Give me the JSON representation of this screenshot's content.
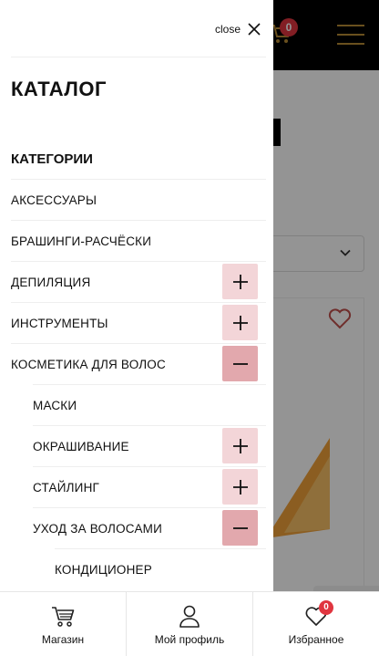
{
  "background": {
    "cart_count": "0"
  },
  "drawer": {
    "close_label": "close",
    "title": "КАТАЛОГ",
    "section_label": "КАТЕГОРИИ",
    "items": [
      {
        "label": "АКСЕССУАРЫ",
        "toggle": "none",
        "indent": 0
      },
      {
        "label": "БРАШИНГИ-РАСЧЁСКИ",
        "toggle": "none",
        "indent": 0
      },
      {
        "label": "ДЕПИЛЯЦИЯ",
        "toggle": "plus",
        "indent": 0
      },
      {
        "label": "ИНСТРУМЕНТЫ",
        "toggle": "plus",
        "indent": 0
      },
      {
        "label": "КОСМЕТИКА ДЛЯ ВОЛОС",
        "toggle": "minus",
        "indent": 0
      },
      {
        "label": "МАСКИ",
        "toggle": "none",
        "indent": 1
      },
      {
        "label": "ОКРАШИВАНИЕ",
        "toggle": "plus",
        "indent": 1
      },
      {
        "label": "СТАЙЛИНГ",
        "toggle": "plus",
        "indent": 1
      },
      {
        "label": "УХОД ЗА ВОЛОСАМИ",
        "toggle": "minus",
        "indent": 1
      },
      {
        "label": "КОНДИЦИОНЕР",
        "toggle": "none",
        "indent": 2
      }
    ]
  },
  "bottom_nav": {
    "shop_label": "Магазин",
    "profile_label": "Мой профиль",
    "wishlist_label": "Избранное",
    "wishlist_count": "0"
  },
  "colors": {
    "accent": "#e0353f",
    "toggle_plus_bg": "#f3d5d8",
    "toggle_minus_bg": "#e2a8ad",
    "brand_gold": "#b58a35"
  },
  "icons": {
    "close": "close-icon",
    "plus": "plus-icon",
    "minus": "minus-icon",
    "shop": "shopping-cart-icon",
    "profile": "user-icon",
    "wishlist": "heart-icon"
  }
}
